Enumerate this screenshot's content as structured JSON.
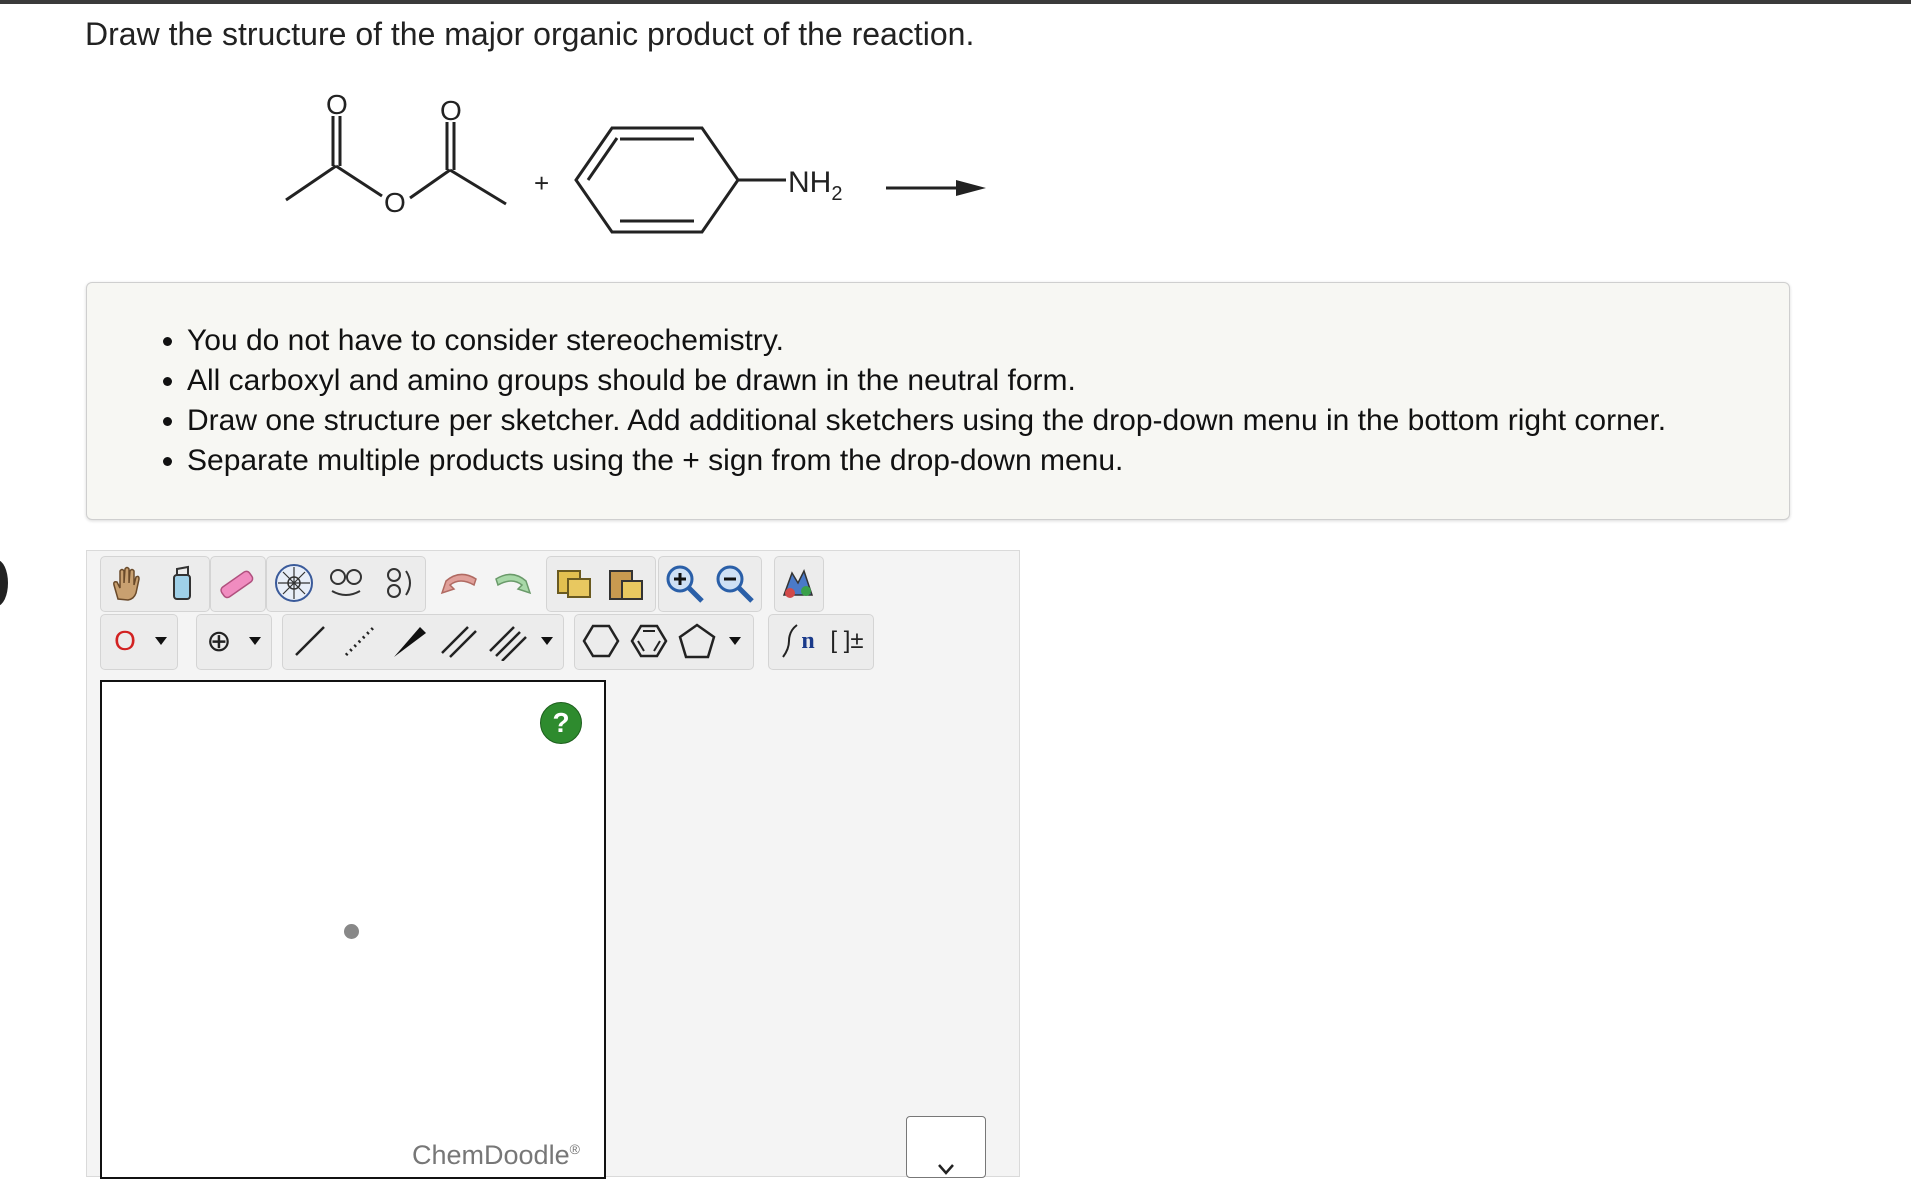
{
  "question": "Draw the structure of the major organic product of the reaction.",
  "reaction": {
    "reactant1_atoms": [
      "O",
      "O",
      "O"
    ],
    "plus": "+",
    "reactant2_group": "NH",
    "reactant2_subscript": "2"
  },
  "instructions": [
    "You do not have to consider stereochemistry.",
    "All carboxyl and amino groups should be drawn in the neutral form.",
    "Draw one structure per sketcher. Add additional sketchers using the drop-down menu in the bottom right corner.",
    "Separate multiple products using the + sign from the drop-down menu."
  ],
  "toolbar": {
    "row1": [
      "hand-icon",
      "clear-icon",
      "eraser-icon",
      "center-icon",
      "flip-horizontal-icon",
      "flip-vertical-icon",
      "undo-icon",
      "redo-icon",
      "copy-icon",
      "paste-icon",
      "zoom-in-icon",
      "zoom-out-icon",
      "clean-icon"
    ],
    "atom_label": "O",
    "charge_label": "⊕",
    "sgroup_label": "n",
    "bracket_label": "[ ]±"
  },
  "canvas": {
    "help_label": "?",
    "brand": "ChemDoodle",
    "brand_mark": "®"
  },
  "colors": {
    "help_green": "#2e8b2e",
    "oxygen_red": "#d22222",
    "zoom_blue": "#2a5fa8"
  }
}
